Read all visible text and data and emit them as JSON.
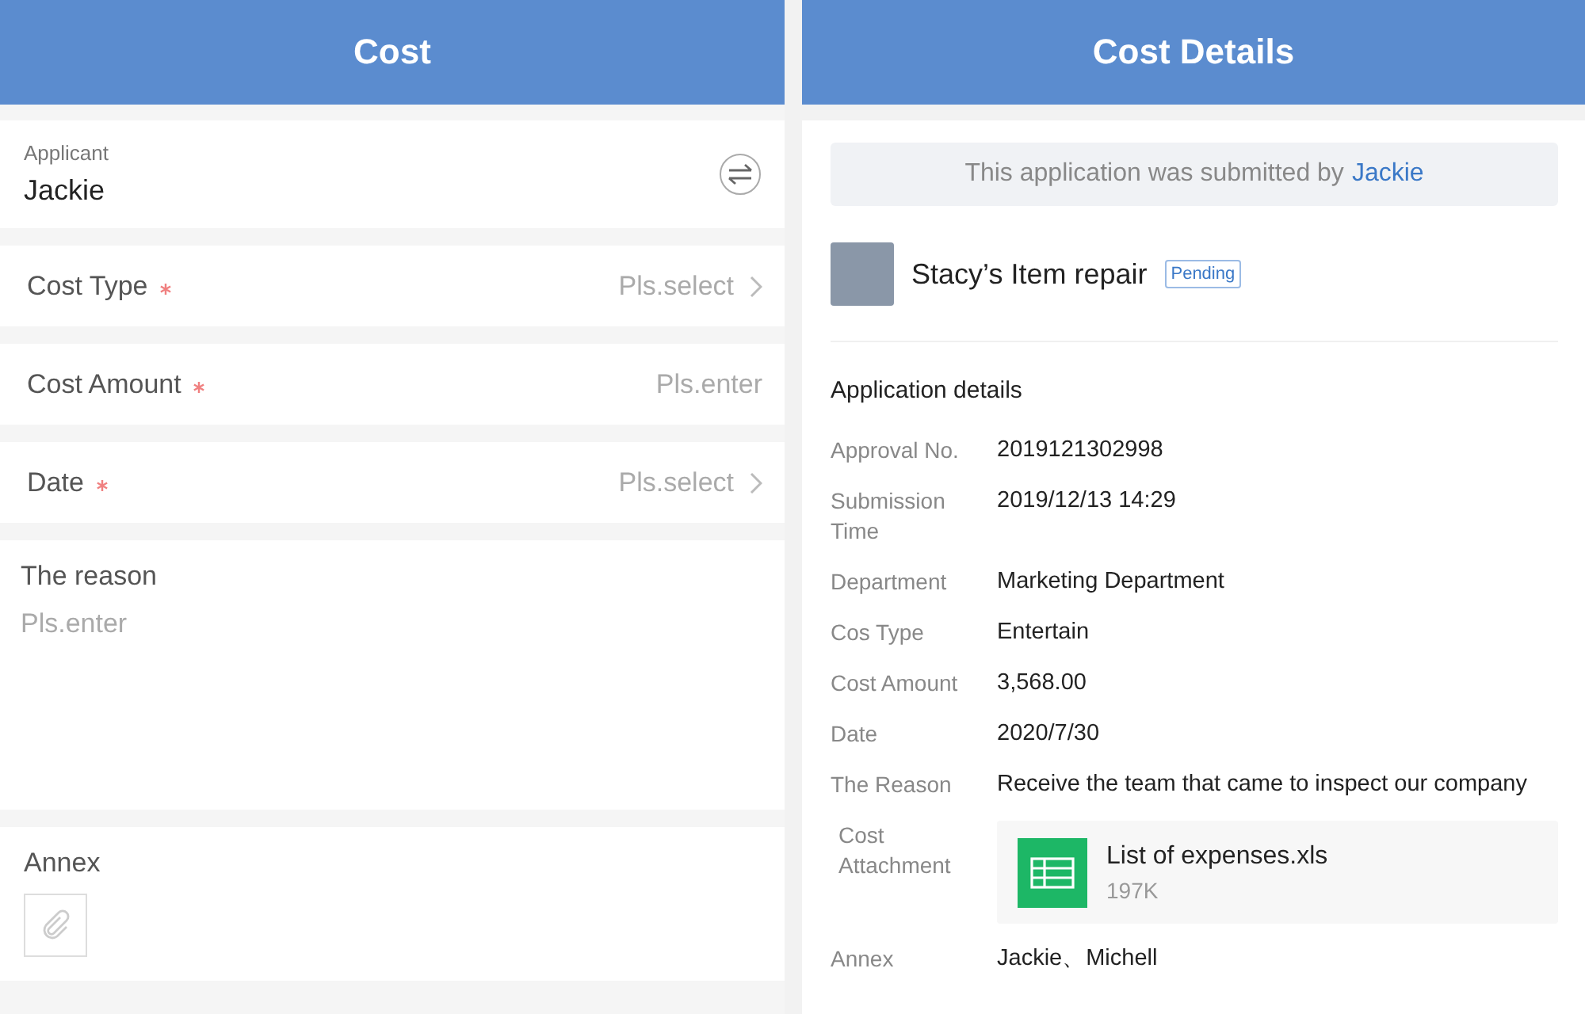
{
  "cost_form": {
    "title": "Cost",
    "applicant": {
      "label": "Applicant",
      "value": "Jackie"
    },
    "fields": [
      {
        "label": "Cost Type",
        "required": true,
        "placeholder": "Pls.select",
        "kind": "select"
      },
      {
        "label": "Cost Amount",
        "required": true,
        "placeholder": "Pls.enter",
        "kind": "input"
      },
      {
        "label": "Date",
        "required": true,
        "placeholder": "Pls.select",
        "kind": "select"
      }
    ],
    "reason": {
      "label": "The reason",
      "placeholder": "Pls.enter"
    },
    "annex": {
      "label": "Annex"
    }
  },
  "cost_details": {
    "title": "Cost Details",
    "banner": {
      "text": "This application was submitted by",
      "submitter": "Jackie"
    },
    "request": {
      "title": "Stacy’s Item repair",
      "status": "Pending"
    },
    "section_title": "Application details",
    "rows": [
      {
        "kind": "text",
        "label": "Approval No.",
        "value": "2019121302998"
      },
      {
        "kind": "text",
        "label": "Submission Time",
        "value": "2019/12/13  14:29"
      },
      {
        "kind": "text",
        "label": "Department",
        "value": "Marketing Department"
      },
      {
        "kind": "text",
        "label": "Cos Type",
        "value": "Entertain"
      },
      {
        "kind": "text",
        "label": "Cost Amount",
        "value": "3,568.00"
      },
      {
        "kind": "text",
        "label": "Date",
        "value": "2020/7/30"
      },
      {
        "kind": "text",
        "label": "The  Reason",
        "value": "Receive the team that came to inspect our company"
      },
      {
        "kind": "file",
        "label": "Cost Attachment",
        "file_name": "List of expenses.xls",
        "file_size": "197K"
      },
      {
        "kind": "text",
        "label": "Annex",
        "value": "Jackie、Michell"
      }
    ]
  }
}
